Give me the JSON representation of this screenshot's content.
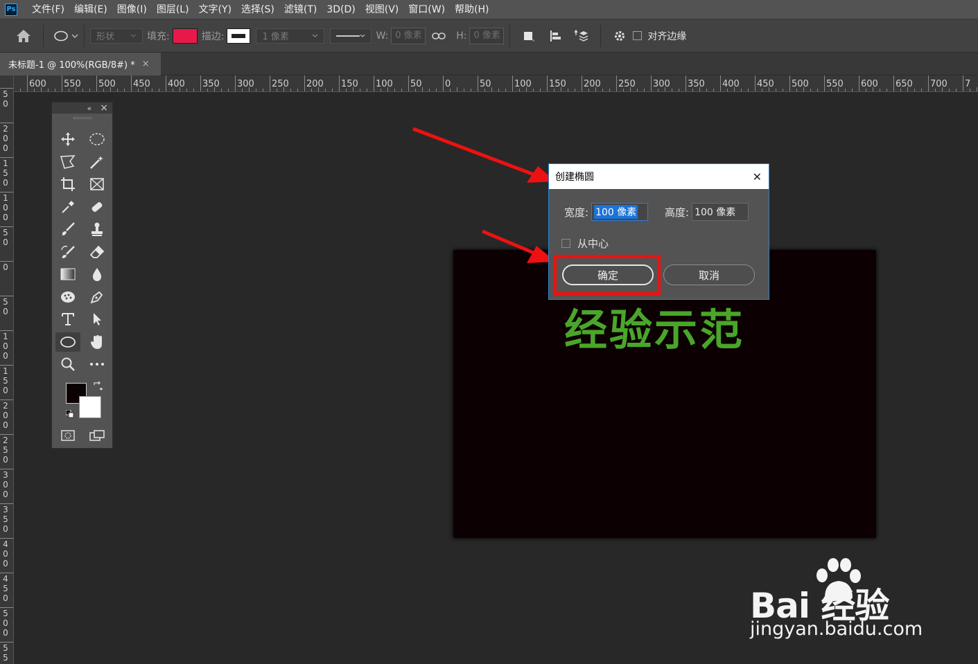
{
  "app": {
    "logo": "Ps"
  },
  "menubar": {
    "items": [
      "文件(F)",
      "编辑(E)",
      "图像(I)",
      "图层(L)",
      "文字(Y)",
      "选择(S)",
      "滤镜(T)",
      "3D(D)",
      "视图(V)",
      "窗口(W)",
      "帮助(H)"
    ]
  },
  "options": {
    "mode_value": "形状",
    "fill_label": "填充:",
    "fill_color": "#e8194a",
    "stroke_label": "描边:",
    "stroke_color": "#ffffff",
    "stroke_width": "1 像素",
    "w_label": "W:",
    "w_value": "0 像素",
    "h_label": "H:",
    "h_value": "0 像素",
    "align_edges_label": "对齐边缘"
  },
  "document_tab": {
    "title": "未标题-1 @ 100%(RGB/8#) *",
    "close": "×"
  },
  "ruler": {
    "top_labels": [
      "50",
      "600",
      "550",
      "500",
      "450",
      "400",
      "350",
      "300",
      "250",
      "200",
      "150",
      "100",
      "50",
      "0",
      "50",
      "100",
      "150",
      "200",
      "250",
      "300",
      "350",
      "400",
      "450",
      "500",
      "550",
      "600",
      "650",
      "700",
      "7"
    ],
    "left_labels": [
      [
        "5",
        "0"
      ],
      [
        "2",
        "0",
        "0"
      ],
      [
        "1",
        "5",
        "0"
      ],
      [
        "1",
        "0",
        "0"
      ],
      [
        "5",
        "0"
      ],
      [
        "0"
      ],
      [
        "5",
        "0"
      ],
      [
        "1",
        "0",
        "0"
      ],
      [
        "1",
        "5",
        "0"
      ],
      [
        "2",
        "0",
        "0"
      ],
      [
        "2",
        "5",
        "0"
      ],
      [
        "3",
        "0",
        "0"
      ],
      [
        "3",
        "5",
        "0"
      ],
      [
        "4",
        "0",
        "0"
      ],
      [
        "4",
        "5",
        "0"
      ],
      [
        "5",
        "0",
        "0"
      ],
      [
        "5",
        "5"
      ]
    ]
  },
  "toolbox": {
    "collapse": "«",
    "close": "×",
    "foreground_color": "#0c0202",
    "background_color": "#ffffff"
  },
  "canvas": {
    "text": "经验示范",
    "text_color": "#4aa62a",
    "background": "#0c0002"
  },
  "dialog": {
    "title": "创建椭圆",
    "close": "✕",
    "width_label": "宽度:",
    "width_value_selected": "100 像素",
    "height_label": "高度:",
    "height_value": "100 像素",
    "from_center_label": "从中心",
    "ok_label": "确定",
    "cancel_label": "取消"
  },
  "watermark": {
    "brand": "Bai  经验",
    "url": "jingyan.baidu.com"
  }
}
